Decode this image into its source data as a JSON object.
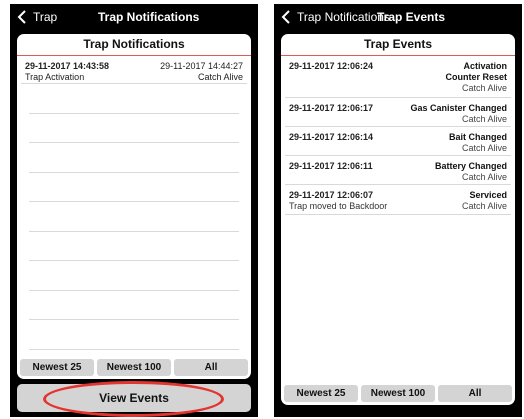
{
  "left_screen": {
    "back_label": "Trap",
    "nav_title": "Trap Notifications",
    "card_title": "Trap Notifications",
    "notifications": [
      {
        "timestamp_left": "29-11-2017 14:43:58",
        "label_left": "Trap Activation",
        "timestamp_right": "29-11-2017 14:44:27",
        "label_right": "Catch Alive"
      }
    ],
    "filters": [
      "Newest 25",
      "Newest 100",
      "All"
    ],
    "view_events_label": "View Events"
  },
  "right_screen": {
    "back_label": "Trap Notifications",
    "nav_title": "Trap Events",
    "card_title": "Trap Events",
    "events": [
      {
        "timestamp": "29-11-2017 12:06:24",
        "note": "",
        "event": "Activation\nCounter Reset",
        "status": "Catch Alive"
      },
      {
        "timestamp": "29-11-2017 12:06:17",
        "note": "",
        "event": "Gas Canister Changed",
        "status": "Catch Alive"
      },
      {
        "timestamp": "29-11-2017 12:06:14",
        "note": "",
        "event": "Bait Changed",
        "status": "Catch Alive"
      },
      {
        "timestamp": "29-11-2017 12:06:11",
        "note": "",
        "event": "Battery Changed",
        "status": "Catch Alive"
      },
      {
        "timestamp": "29-11-2017 12:06:07",
        "note": "Trap moved to Backdoor",
        "event": "Serviced",
        "status": "Catch Alive"
      }
    ],
    "filters": [
      "Newest 25",
      "Newest 100",
      "All"
    ]
  },
  "colors": {
    "header_divider": "#e05a55",
    "highlight": "#e3342f",
    "button_bg": "#d4d4d4",
    "phone_bg": "#000000"
  }
}
